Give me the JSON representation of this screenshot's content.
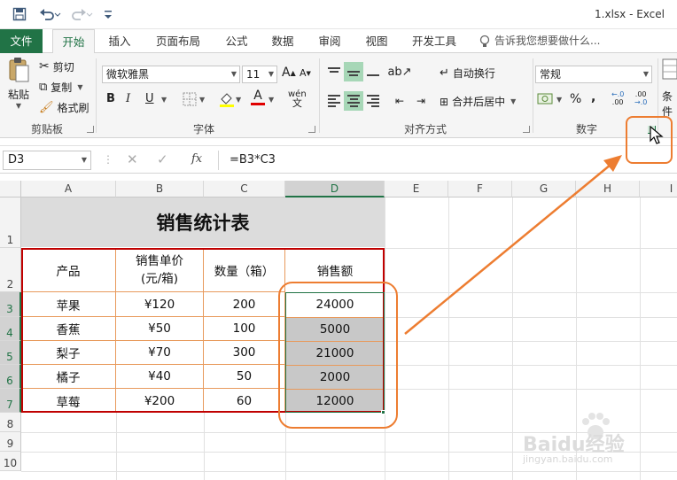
{
  "window": {
    "title": "1.xlsx - Excel"
  },
  "quick_access": {
    "save_icon": "save-icon",
    "undo_icon": "undo-icon",
    "redo_icon": "redo-icon",
    "customize_icon": "customize-icon"
  },
  "tabs": [
    {
      "label": "文件"
    },
    {
      "label": "开始"
    },
    {
      "label": "插入"
    },
    {
      "label": "页面布局"
    },
    {
      "label": "公式"
    },
    {
      "label": "数据"
    },
    {
      "label": "审阅"
    },
    {
      "label": "视图"
    },
    {
      "label": "开发工具"
    }
  ],
  "tell_me": {
    "placeholder": "告诉我您想要做什么..."
  },
  "ribbon": {
    "clipboard": {
      "label": "剪贴板",
      "paste": "粘贴",
      "cut": "剪切",
      "copy": "复制",
      "format_painter": "格式刷"
    },
    "font": {
      "label": "字体",
      "font_name": "微软雅黑",
      "font_size": "11",
      "bold": "B",
      "italic": "I",
      "underline": "U",
      "wen": "wén",
      "grow": "A",
      "shrink": "A",
      "color_a": "A"
    },
    "alignment": {
      "label": "对齐方式",
      "wrap_text": "自动换行",
      "merge_center": "合并后居中"
    },
    "number": {
      "label": "数字",
      "format": "常规",
      "percent": "%",
      "comma": ",",
      "inc_decimal": ".00",
      "dec_decimal": ".00",
      "truncated": "条件"
    }
  },
  "formula_bar": {
    "name_box": "D3",
    "fx": "fx",
    "formula": "=B3*C3"
  },
  "grid": {
    "columns": [
      "A",
      "B",
      "C",
      "D",
      "E",
      "F",
      "G",
      "H",
      "I"
    ],
    "rows": [
      "1",
      "2",
      "3",
      "4",
      "5",
      "6",
      "7",
      "8",
      "9",
      "10"
    ],
    "table_title": "销售统计表",
    "headers": [
      "产品",
      "销售单价\n(元/箱)",
      "数量（箱）",
      "销售额"
    ],
    "data": [
      [
        "苹果",
        "¥120",
        "200",
        "24000"
      ],
      [
        "香蕉",
        "¥50",
        "100",
        "5000"
      ],
      [
        "梨子",
        "¥70",
        "300",
        "21000"
      ],
      [
        "橘子",
        "¥40",
        "50",
        "2000"
      ],
      [
        "草莓",
        "¥200",
        "60",
        "12000"
      ]
    ]
  },
  "watermark": {
    "text": "Baidu经验",
    "url": "jingyan.baidu.com"
  },
  "colors": {
    "excel_green": "#217346",
    "highlight_orange": "#ed7d31",
    "table_red": "#c00000",
    "selection_gray": "#c8c8c8"
  }
}
